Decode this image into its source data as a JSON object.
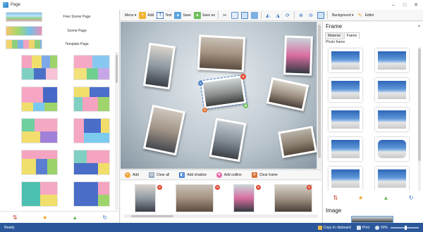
{
  "window": {
    "title": "Page",
    "minimize": "–",
    "maximize": "□",
    "close": "✕"
  },
  "left_panel": {
    "pages": [
      {
        "label": "Free Scene Page"
      },
      {
        "label": "Scene Page"
      },
      {
        "label": "Template Page"
      }
    ],
    "tools": [
      {
        "icon": "sort-icon",
        "glyph": "⇅"
      },
      {
        "icon": "star-icon",
        "glyph": "★"
      },
      {
        "icon": "cone-icon",
        "glyph": "▲"
      },
      {
        "icon": "refresh-icon",
        "glyph": "↻"
      }
    ]
  },
  "toolbar": {
    "menu_label": "Menu ▾",
    "add_label": "Add",
    "text_label": "Text",
    "save_label": "Save",
    "save_as_label": "Save as",
    "background_label": "Background ▾",
    "editor_label": "Editor"
  },
  "photos_bar": {
    "add_label": "Add",
    "clear_all_label": "Clear all",
    "add_shadow_label": "Add shadow",
    "add_outline_label": "Add outline",
    "clear_frame_label": "Clear frame"
  },
  "right_panel": {
    "title": "Frame",
    "tabs": [
      "Material",
      "Frame"
    ],
    "active_tab": "Frame",
    "subheader": "Photo frame",
    "image_title": "Image"
  },
  "status": {
    "left": "Ready",
    "copy_label": "Copy to clipboard",
    "print_label": "Print",
    "zoom_label": "50%",
    "zoom_level": 0.5
  },
  "colors": {
    "accent": "#2b579a",
    "delete_badge": "#e0452f"
  }
}
